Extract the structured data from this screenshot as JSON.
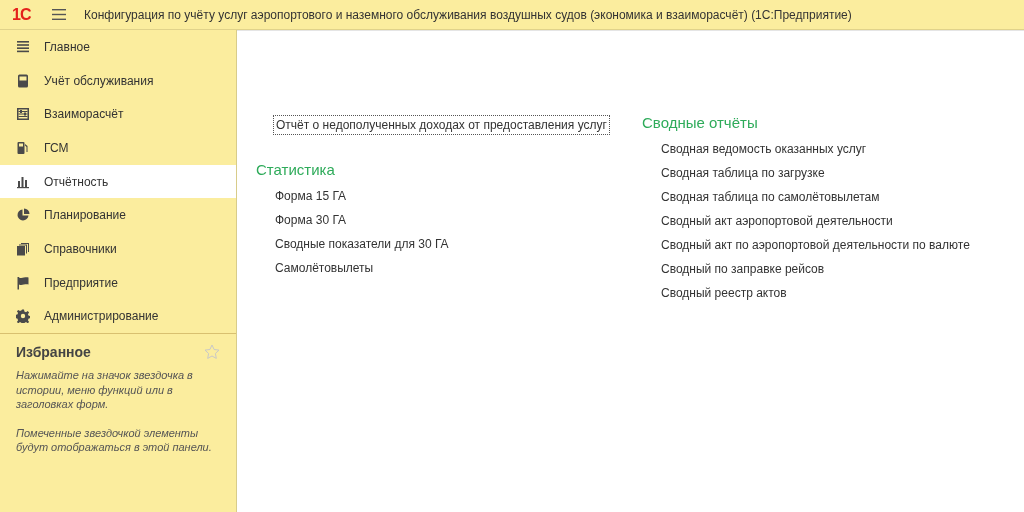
{
  "header": {
    "logo": "1С",
    "title": "Конфигурация по учёту услуг аэропортового и наземного обслуживания воздушных судов (экономика и взаиморасчёт)  (1С:Предприятие)"
  },
  "sidebar": {
    "items": [
      {
        "label": "Главное",
        "selected": false
      },
      {
        "label": "Учёт обслуживания",
        "selected": false
      },
      {
        "label": "Взаиморасчёт",
        "selected": false
      },
      {
        "label": "ГСМ",
        "selected": false
      },
      {
        "label": "Отчётность",
        "selected": true
      },
      {
        "label": "Планирование",
        "selected": false
      },
      {
        "label": "Справочники",
        "selected": false
      },
      {
        "label": "Предприятие",
        "selected": false
      },
      {
        "label": "Администрирование",
        "selected": false
      }
    ]
  },
  "favorites": {
    "title": "Избранное",
    "paragraphs": [
      "Нажимайте на значок звездочка в истории, меню функций или в заголовках форм.",
      "Помеченные звездочкой элементы будут отображаться в этой панели."
    ]
  },
  "content": {
    "top_link": {
      "text": "Отчёт о недополученных доходах от предоставления услуг",
      "focused": true
    },
    "sections": [
      {
        "title": "Статистика",
        "links": [
          "Форма 15 ГА",
          "Форма 30 ГА",
          "Сводные показатели для 30 ГА",
          "Самолётовылеты"
        ]
      },
      {
        "title": "Сводные отчёты",
        "links": [
          "Сводная ведомость оказанных услуг",
          "Сводная таблица по загрузке",
          "Сводная таблица по самолётовылетам",
          "Сводный акт аэропортовой деятельности",
          "Сводный акт по аэропортовой деятельности по валюте",
          "Сводный по заправке рейсов",
          "Сводный реестр актов"
        ]
      }
    ]
  }
}
